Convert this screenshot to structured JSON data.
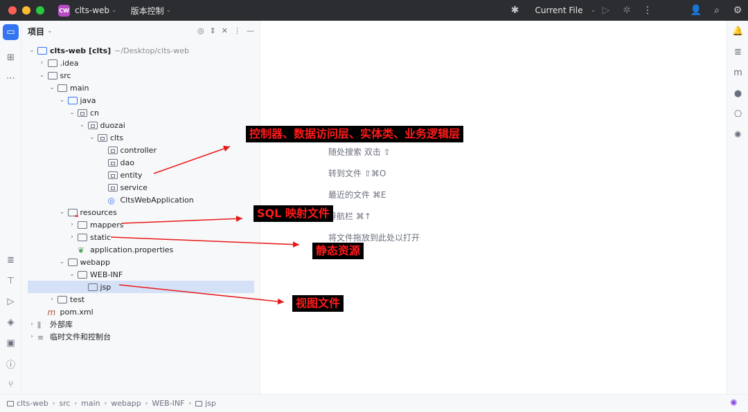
{
  "titlebar": {
    "project_badge": "CW",
    "project_name": "clts-web",
    "vcs_label": "版本控制",
    "current_file": "Current File",
    "traffic_colors": [
      "#fe5f57",
      "#febc2e",
      "#28c840"
    ]
  },
  "panel": {
    "title": "项目",
    "tree": [
      {
        "level": 0,
        "arrow": "open",
        "icon": "module-folder",
        "label": "clts-web [clts]",
        "suffix": "~/Desktop/clts-web",
        "bold": true
      },
      {
        "level": 1,
        "arrow": "closed",
        "icon": "folder",
        "label": ".idea"
      },
      {
        "level": 1,
        "arrow": "open",
        "icon": "folder",
        "label": "src"
      },
      {
        "level": 2,
        "arrow": "open",
        "icon": "folder",
        "label": "main"
      },
      {
        "level": 3,
        "arrow": "open",
        "icon": "source-folder",
        "label": "java"
      },
      {
        "level": 4,
        "arrow": "open",
        "icon": "package",
        "label": "cn"
      },
      {
        "level": 5,
        "arrow": "open",
        "icon": "package",
        "label": "duozai"
      },
      {
        "level": 6,
        "arrow": "open",
        "icon": "package",
        "label": "clts"
      },
      {
        "level": 7,
        "arrow": "none",
        "icon": "package",
        "label": "controller"
      },
      {
        "level": 7,
        "arrow": "none",
        "icon": "package",
        "label": "dao"
      },
      {
        "level": 7,
        "arrow": "none",
        "icon": "package",
        "label": "entity"
      },
      {
        "level": 7,
        "arrow": "none",
        "icon": "package",
        "label": "service"
      },
      {
        "level": 7,
        "arrow": "none",
        "icon": "spring-class",
        "label": "CltsWebApplication"
      },
      {
        "level": 3,
        "arrow": "open",
        "icon": "resources-folder",
        "label": "resources"
      },
      {
        "level": 4,
        "arrow": "closed",
        "icon": "folder",
        "label": "mappers"
      },
      {
        "level": 4,
        "arrow": "closed",
        "icon": "folder",
        "label": "static"
      },
      {
        "level": 4,
        "arrow": "none",
        "icon": "properties-file",
        "label": "application.properties"
      },
      {
        "level": 3,
        "arrow": "open",
        "icon": "folder",
        "label": "webapp"
      },
      {
        "level": 4,
        "arrow": "open",
        "icon": "folder",
        "label": "WEB-INF"
      },
      {
        "level": 5,
        "arrow": "none",
        "icon": "folder",
        "label": "jsp",
        "selected": true
      },
      {
        "level": 2,
        "arrow": "closed",
        "icon": "folder",
        "label": "test"
      },
      {
        "level": 1,
        "arrow": "none",
        "icon": "maven-file",
        "label": "pom.xml"
      },
      {
        "level": 0,
        "arrow": "closed",
        "icon": "library",
        "label": "外部库"
      },
      {
        "level": 0,
        "arrow": "closed",
        "icon": "scratches",
        "label": "临时文件和控制台"
      }
    ]
  },
  "editor": {
    "hints": [
      "随处搜索 双击 ⇧",
      "转到文件 ⇧⌘O",
      "最近的文件 ⌘E",
      "导航栏 ⌘↑",
      "将文件拖放到此处以打开"
    ]
  },
  "statusbar": {
    "breadcrumbs": [
      "clts-web",
      "src",
      "main",
      "webapp",
      "WEB-INF",
      "jsp"
    ]
  },
  "annotations": [
    "控制器、数据访问层、实体类、业务逻辑层",
    "SQL 映射文件",
    "静态资源",
    "视图文件"
  ]
}
